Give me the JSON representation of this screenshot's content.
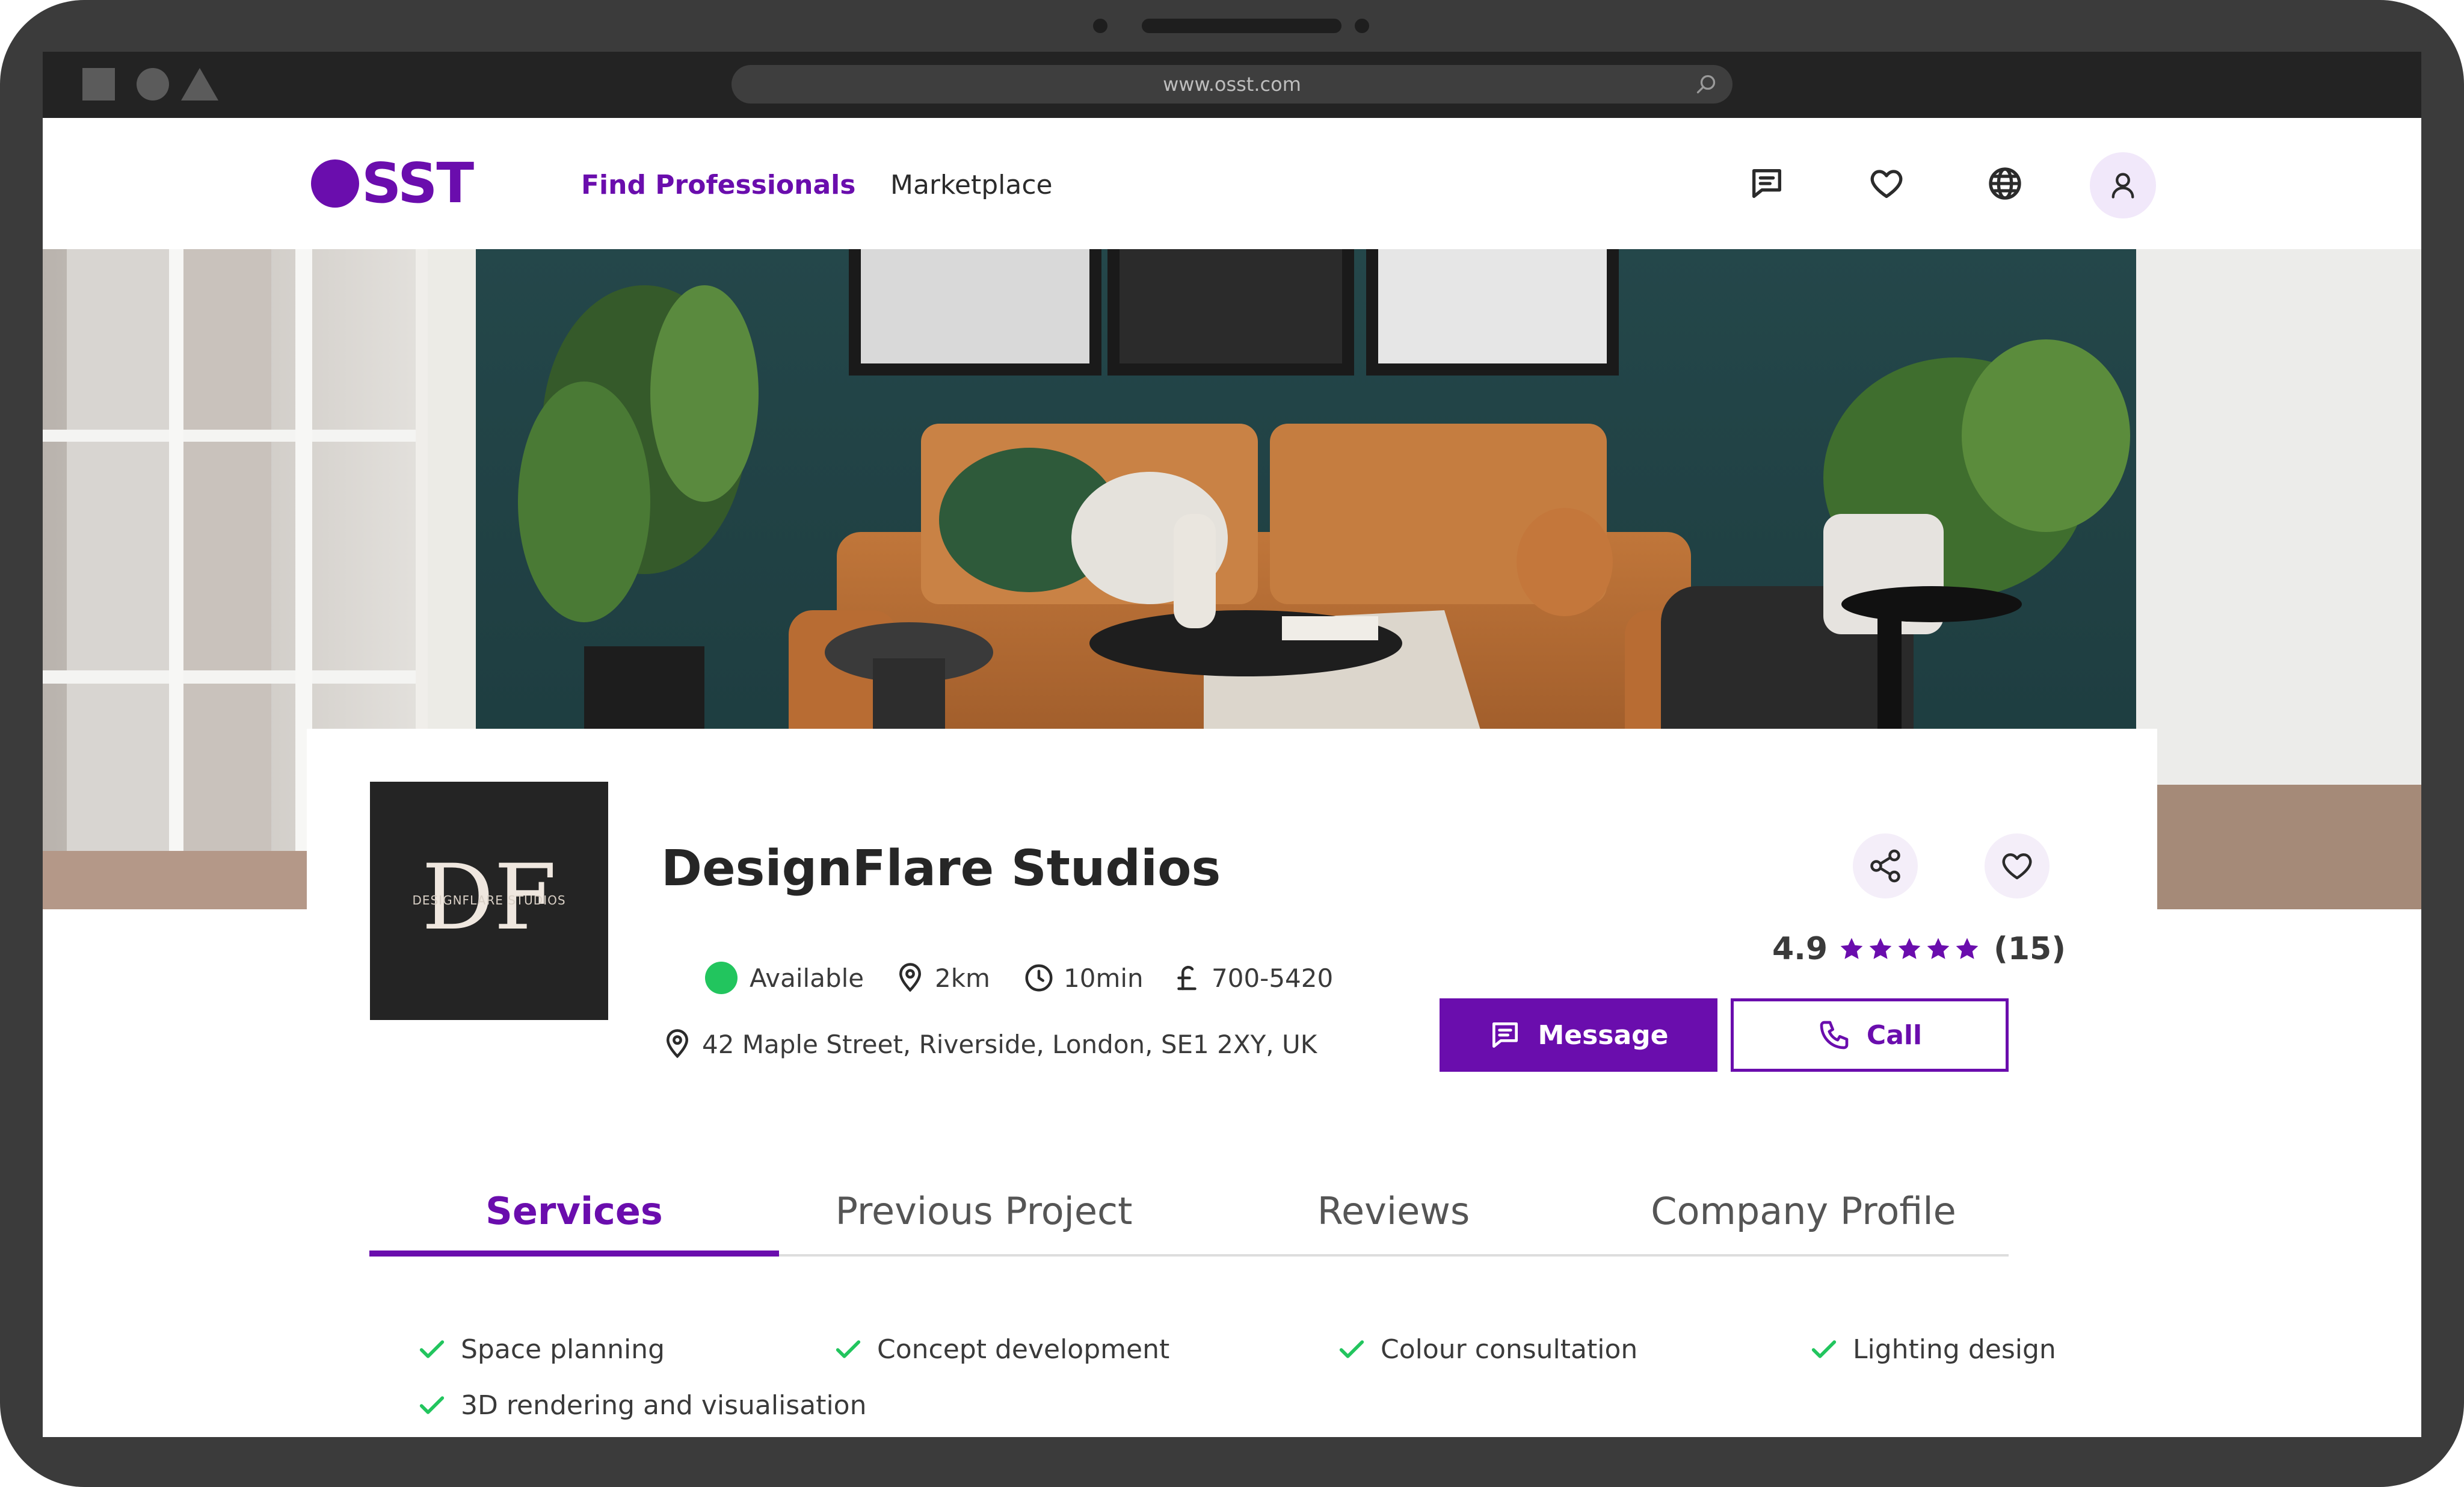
{
  "browser": {
    "url": "www.osst.com"
  },
  "brand": {
    "logo_text": "SST",
    "accent_color": "#6a0dad"
  },
  "nav": {
    "links": [
      {
        "label": "Find Professionals",
        "active": true
      },
      {
        "label": "Marketplace",
        "active": false
      }
    ],
    "icons": [
      "chat-icon",
      "heart-icon",
      "globe-icon",
      "user-icon"
    ]
  },
  "profile": {
    "logo_monogram": "DF",
    "logo_caption": "DESIGNFLARE STUDIOS",
    "name": "DesignFlare Studios",
    "status": "Available",
    "status_color": "#22c55e",
    "distance": "2km",
    "time": "10min",
    "price_range": "700-5420",
    "address": "42 Maple Street, Riverside, London, SE1 2XY, UK",
    "rating": "4.9",
    "stars": 5,
    "review_count": "(15)",
    "message_label": "Message",
    "call_label": "Call"
  },
  "tabs": [
    {
      "label": "Services",
      "active": true
    },
    {
      "label": "Previous Project",
      "active": false
    },
    {
      "label": "Reviews",
      "active": false
    },
    {
      "label": "Company Profile",
      "active": false
    }
  ],
  "services": [
    "Space planning",
    "Concept development",
    "Colour consultation",
    "Lighting design",
    "3D rendering and visualisation"
  ]
}
